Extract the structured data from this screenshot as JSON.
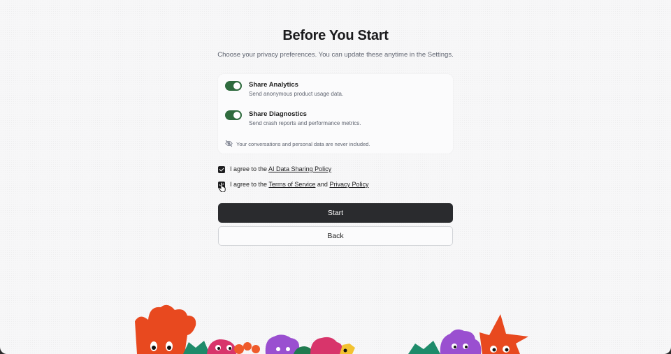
{
  "page": {
    "title": "Before You Start",
    "subtitle": "Choose your privacy preferences. You can update these anytime in the Settings."
  },
  "options": [
    {
      "title": "Share Analytics",
      "description": "Send anonymous product usage data.",
      "enabled": true
    },
    {
      "title": "Share Diagnostics",
      "description": "Send crash reports and performance metrics.",
      "enabled": true
    }
  ],
  "privacy_note": "Your conversations and personal data are never included.",
  "agreements": {
    "one": {
      "prefix": "I agree to the ",
      "link": "AI Data Sharing Policy",
      "checked": true
    },
    "two": {
      "prefix": "I agree to the ",
      "link1": "Terms of Service",
      "middle": " and ",
      "link2": "Privacy Policy",
      "checked": true
    }
  },
  "buttons": {
    "start": "Start",
    "back": "Back"
  },
  "colors": {
    "toggle_on": "#2f6b3e",
    "primary_button": "#2a2b2e",
    "title": "#1b1b1d"
  }
}
